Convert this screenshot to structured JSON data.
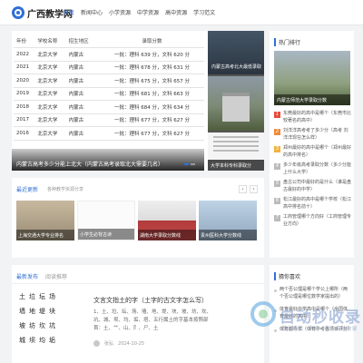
{
  "site": {
    "logo_text": "广西教学网"
  },
  "nav": {
    "items": [
      "首页",
      "新闻中心",
      "小学资源",
      "中学资源",
      "高中资源",
      "学习范文"
    ],
    "active_index": 0
  },
  "hero": {
    "table": {
      "headers": [
        "年份",
        "学校名称",
        "招生地区",
        "录取分数"
      ],
      "rows": [
        [
          "2022",
          "北京大学",
          "内蒙古",
          "一批：理科 639 分，文科 620 分"
        ],
        [
          "2021",
          "北京大学",
          "内蒙古",
          "一批：理科 678 分，文科 631 分"
        ],
        [
          "2020",
          "北京大学",
          "内蒙古",
          "一批：理科 675 分，文科 657 分"
        ],
        [
          "2019",
          "北京大学",
          "内蒙古",
          "一批：理科 681 分，文科 663 分"
        ],
        [
          "2018",
          "北京大学",
          "内蒙古",
          "一批：理科 684 分，文科 634 分"
        ],
        [
          "2017",
          "北京大学",
          "内蒙古",
          "一批：理科 677 分，文科 627 分"
        ],
        [
          "2016",
          "北京大学",
          "内蒙古",
          "一批：理科 677 分，文科 627 分"
        ]
      ]
    },
    "caption": "内蒙古高考多少分能上北大（内蒙古高考录取北大需要几名）",
    "side_top_caption": "内蒙古高考北大最低录取",
    "side_bottom_caption": "大学本科专科录取分"
  },
  "recent": {
    "title": "最近更新",
    "subtitle": "各种教学资源分享",
    "prev_icon": "‹",
    "next_icon": "›",
    "items": [
      {
        "caption": "上海交通大学专业排名"
      },
      {
        "caption": "小学生必背古诗"
      },
      {
        "caption": "湖南大学录取分数线"
      },
      {
        "caption": "贵州医科大学分数线"
      }
    ]
  },
  "latest": {
    "tabs": [
      "最新发布",
      "阅读推荐"
    ],
    "active_tab": 0,
    "article": {
      "title": "文言文指土的字（土字的古文字怎么写）",
      "snippet": "1、土、垃、坛、场、墙、地、堤、块、坡、坊、坎、坑、城、坝、均、垢、塔、五行属土的字基本按照部首：土、艹、山、阝、尸、土",
      "image_rows": [
        [
          "土",
          "垃",
          "坛",
          "场"
        ],
        [
          "墙",
          "地",
          "堤",
          "块"
        ],
        [
          "坡",
          "坊",
          "坎",
          "坑"
        ],
        [
          "城",
          "坝",
          "均",
          "垢"
        ]
      ],
      "author": "张弘",
      "date": "2024-10-25"
    }
  },
  "hot": {
    "title": "热门排行",
    "top_caption": "内蒙古师范大学录取分数",
    "items": [
      "东莞最好的高中是哪个（东莞市比较著名的高中）",
      "刘洋洋高考考了多少分（高考 刘洋洋现在怎么样）",
      "郑州最好的高中是哪个（郑州最好的高中排名）",
      "多少年级高考录取分数（多少分能上什么大学）",
      "盘古公司中最好的是什么（谁是盘古最好的中学）",
      "松江最好的高中是哪个学校（松江高中排名前十）",
      "工商管理哪个方向好（工商管理专业方向）"
    ]
  },
  "guess": {
    "title": "猜你喜欢",
    "items": [
      "两个否公理是哪个学公上哪所（两个否公理是哪位数学家提出的）",
      "体育最好中学高中是哪个（全国体育最好的高中）",
      "体育都今年（体育中考各项目评分）"
    ]
  },
  "watermark": {
    "text": "自动秒收录",
    "sub": "做上链接 · 来访一次 · 自动收录"
  }
}
